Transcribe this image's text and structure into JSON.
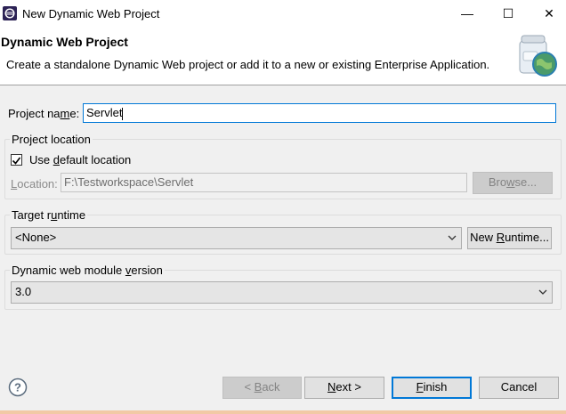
{
  "window": {
    "title": "New Dynamic Web Project",
    "minimize_glyph": "—",
    "maximize_glyph": "☐",
    "close_glyph": "✕"
  },
  "header": {
    "title": "Dynamic Web Project",
    "description": "Create a standalone Dynamic Web project or add it to a new or existing Enterprise Application."
  },
  "project_name": {
    "label_pre": "Project na",
    "label_mnemonic": "m",
    "label_post": "e:",
    "value": "Servlet"
  },
  "project_location": {
    "group_title": "Project location",
    "use_default_pre": "Use ",
    "use_default_mnemonic": "d",
    "use_default_post": "efault location",
    "use_default_checked": true,
    "location_mnemonic": "L",
    "location_post": "ocation:",
    "location_value": "F:\\Testworkspace\\Servlet",
    "browse_pre": "Bro",
    "browse_mnemonic": "w",
    "browse_post": "se..."
  },
  "target_runtime": {
    "group_title_pre": "Target r",
    "group_title_mnemonic": "u",
    "group_title_post": "ntime",
    "selected": "<None>",
    "new_runtime_pre": "New ",
    "new_runtime_mnemonic": "R",
    "new_runtime_post": "untime..."
  },
  "module_version": {
    "group_title_pre": "Dynamic web module ",
    "group_title_mnemonic": "v",
    "group_title_post": "ersion",
    "selected": "3.0"
  },
  "buttons": {
    "back_pre": "< ",
    "back_mnemonic": "B",
    "back_post": "ack",
    "next_mnemonic": "N",
    "next_post": "ext >",
    "finish_mnemonic": "F",
    "finish_post": "inish",
    "cancel": "Cancel"
  },
  "icons": {
    "app": "eclipse-icon",
    "header": "web-project-jar-globe-icon",
    "help": "help-icon"
  },
  "colors": {
    "focus_blue": "#0078d7",
    "header_bg": "#ffffff",
    "body_bg": "#f0f0f0"
  }
}
